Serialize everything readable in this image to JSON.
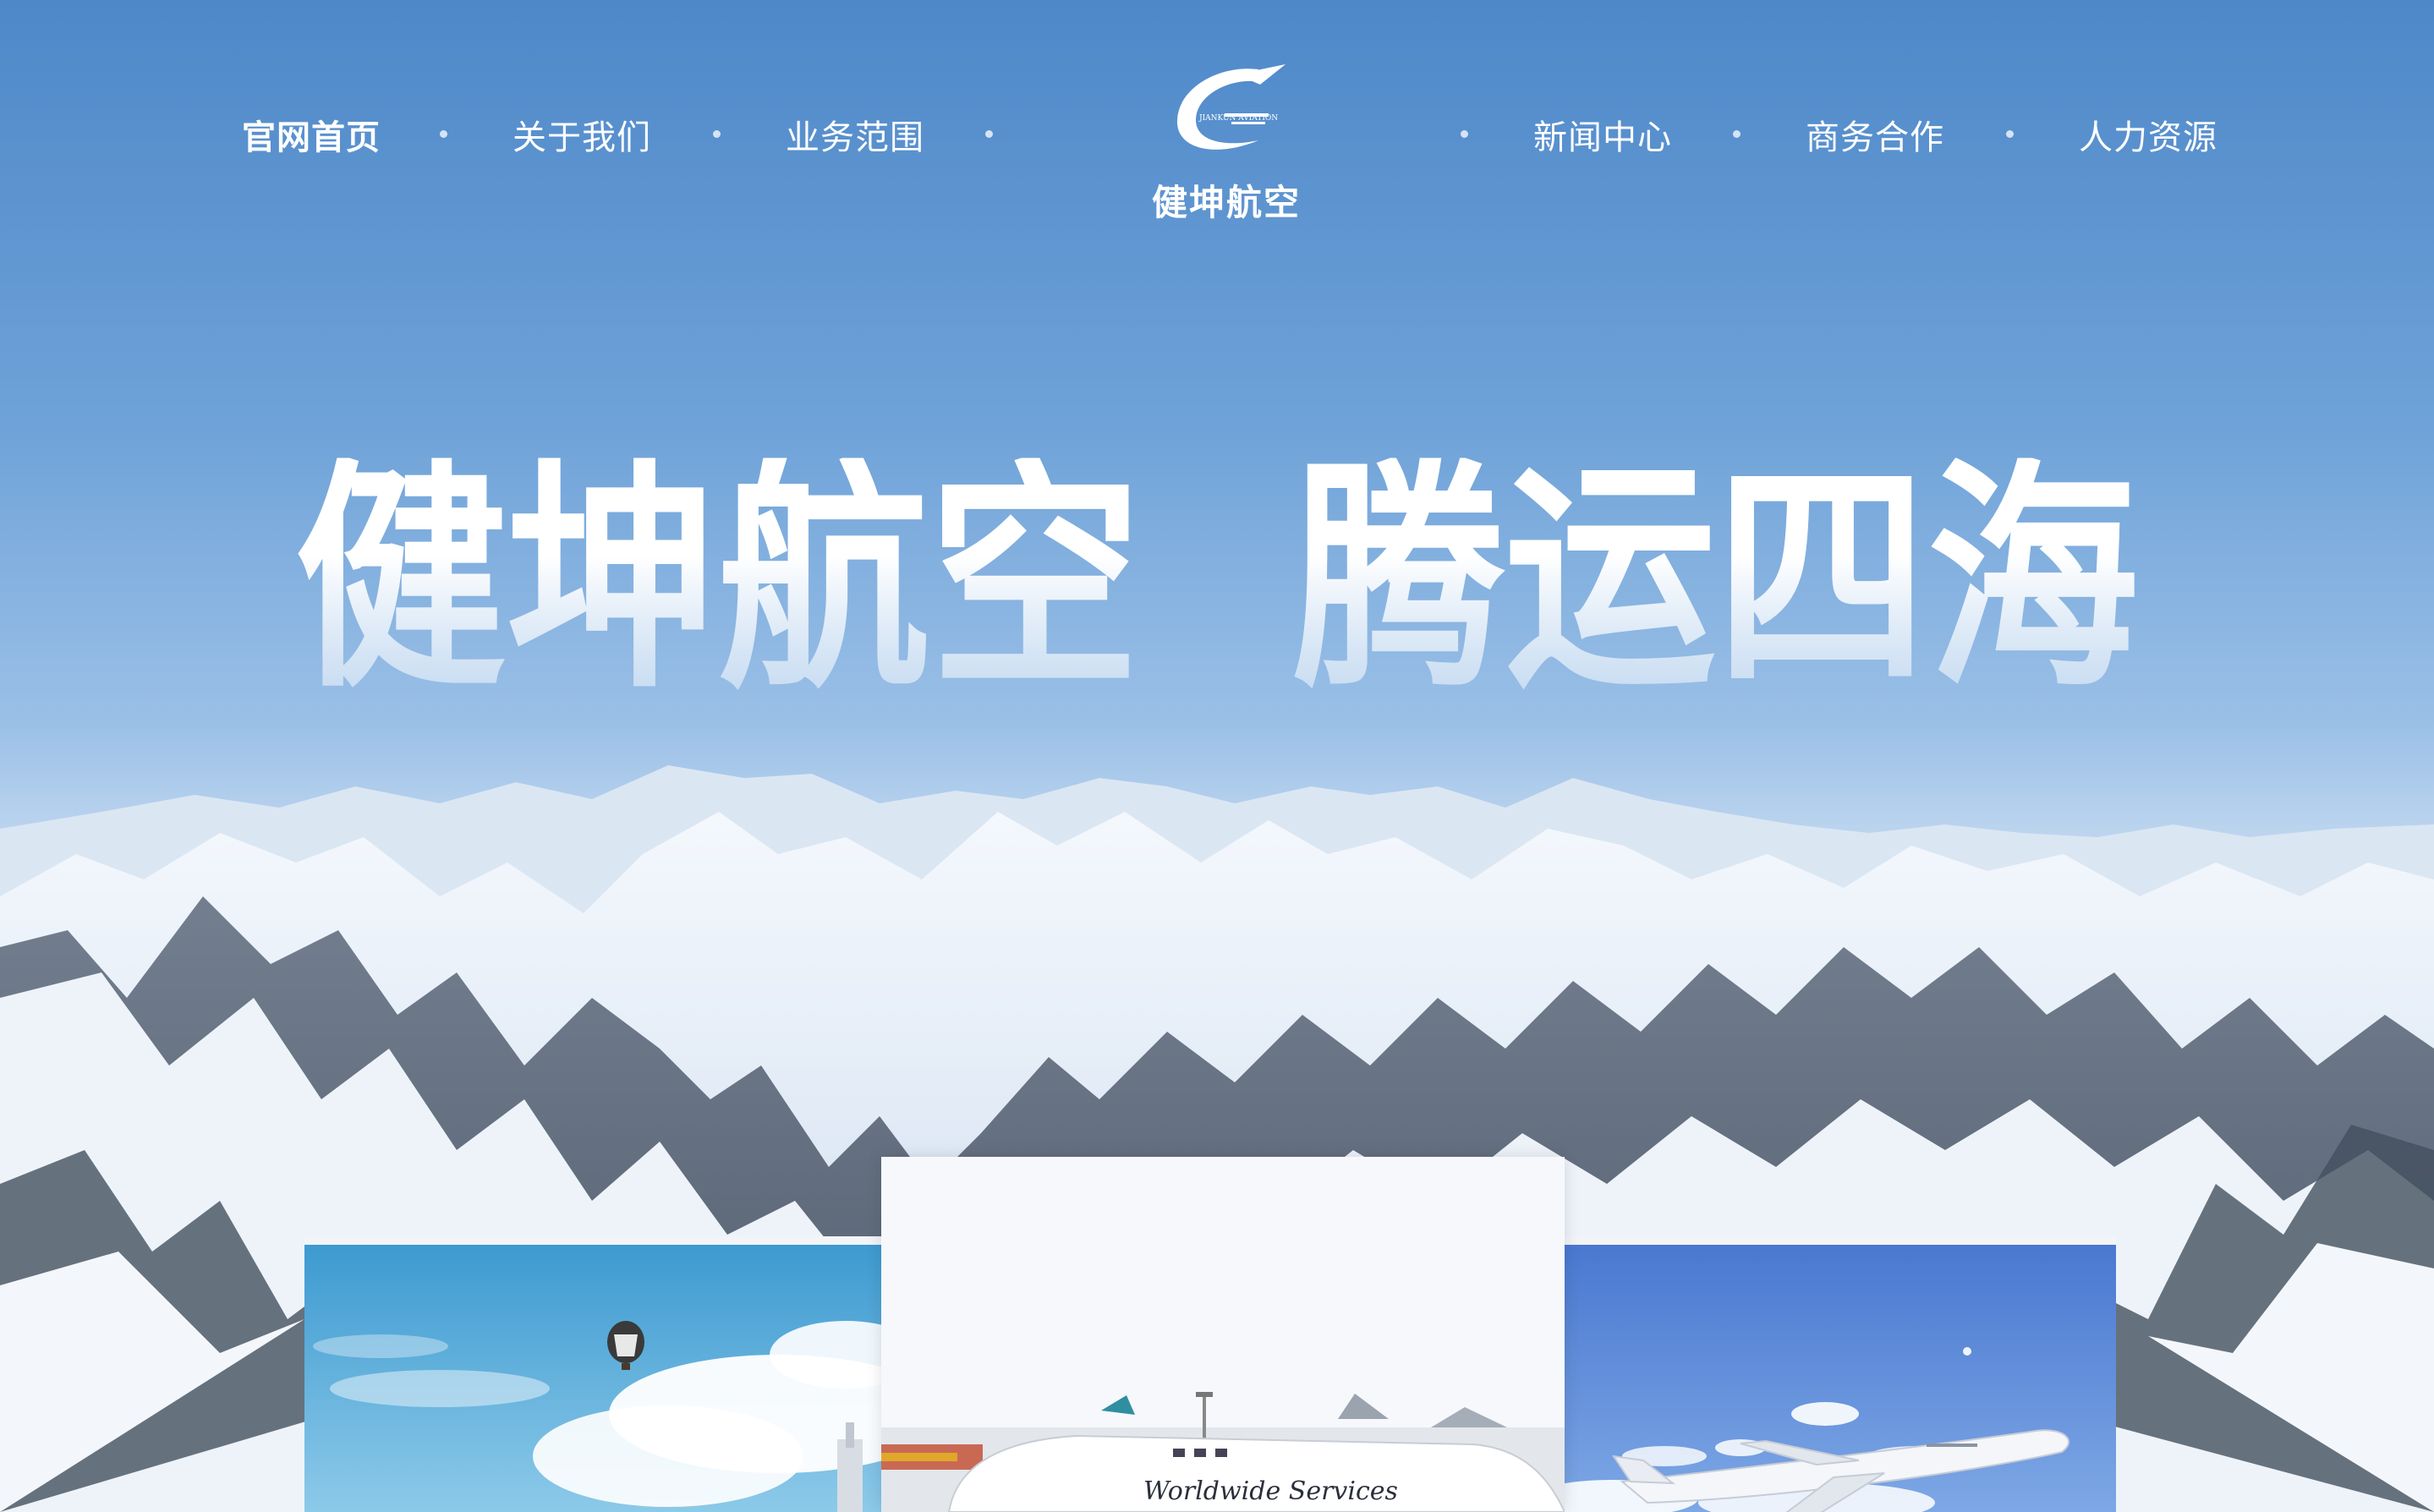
{
  "nav": {
    "left_items": [
      {
        "label": "官网首页",
        "active": true
      },
      {
        "label": "关于我们",
        "active": false
      },
      {
        "label": "业务范围",
        "active": false
      }
    ],
    "right_items": [
      {
        "label": "新闻中心",
        "active": false
      },
      {
        "label": "商务合作",
        "active": false
      },
      {
        "label": "人力资源",
        "active": false
      }
    ]
  },
  "logo": {
    "name": "健坤航空",
    "emblem_text": "JIANKUN AVIATION",
    "icon": "swoosh-plane-icon"
  },
  "hero": {
    "slogan_part1": "健坤航空",
    "slogan_part2": "腾运四海"
  },
  "cards": {
    "center_plane_text": "Worldwide Services"
  },
  "colors": {
    "sky_top": "#4e88c9",
    "sky_mid": "#9bc0e7",
    "nav_text": "#ffffff"
  }
}
